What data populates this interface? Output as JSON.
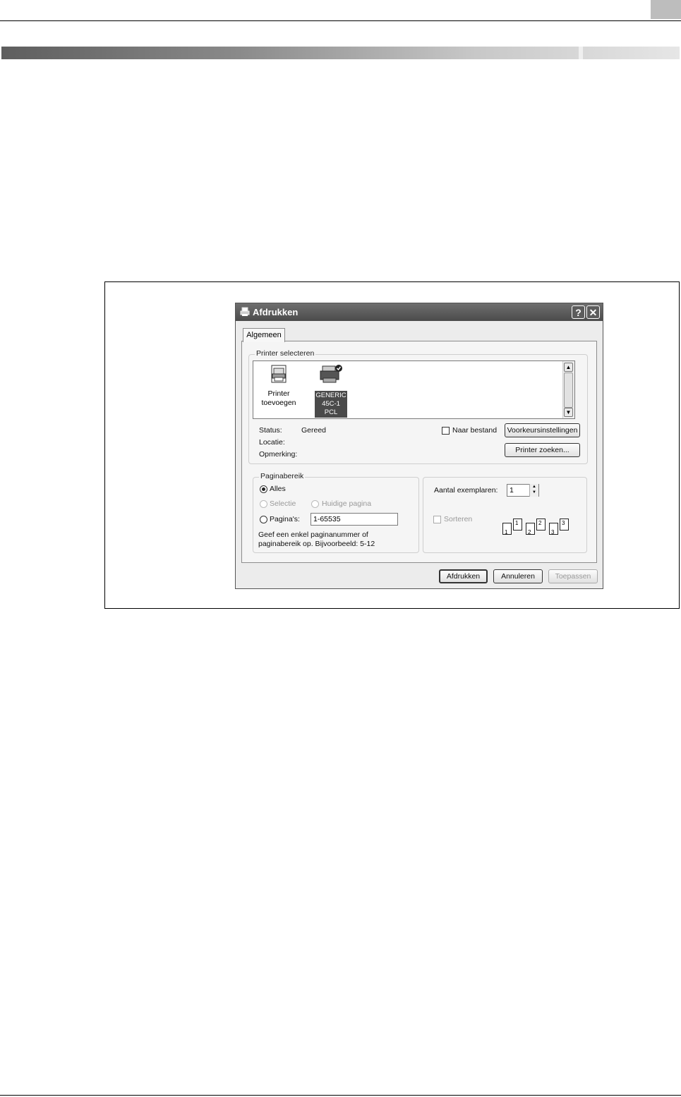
{
  "dialog": {
    "title": "Afdrukken",
    "help_glyph": "?",
    "close_glyph": "✕",
    "tab_label": "Algemeen",
    "printer_group": {
      "label": "Printer selecteren",
      "printers": [
        {
          "label": "Printer toevoegen"
        },
        {
          "label_lines": [
            "GENERIC",
            "45C-1",
            "PCL"
          ]
        }
      ],
      "status_label": "Status:",
      "status_value": "Gereed",
      "location_label": "Locatie:",
      "comment_label": "Opmerking:",
      "print_to_file_label": "Naar bestand",
      "preferences_button": "Voorkeursinstellingen",
      "find_printer_button": "Printer zoeken..."
    },
    "page_range": {
      "label": "Paginabereik",
      "all": "Alles",
      "selection": "Selectie",
      "current_page": "Huidige pagina",
      "pages": "Pagina's:",
      "pages_value": "1-65535",
      "hint_line1": "Geef een enkel paginanummer of",
      "hint_line2": "paginabereik op. Bijvoorbeeld: 5-12"
    },
    "copies": {
      "label": "Aantal exemplaren:",
      "value": "1",
      "collate_label": "Sorteren",
      "collate_pages": [
        "1",
        "1",
        "2",
        "2",
        "3",
        "3"
      ]
    },
    "buttons": {
      "print": "Afdrukken",
      "cancel": "Annuleren",
      "apply": "Toepassen"
    }
  }
}
